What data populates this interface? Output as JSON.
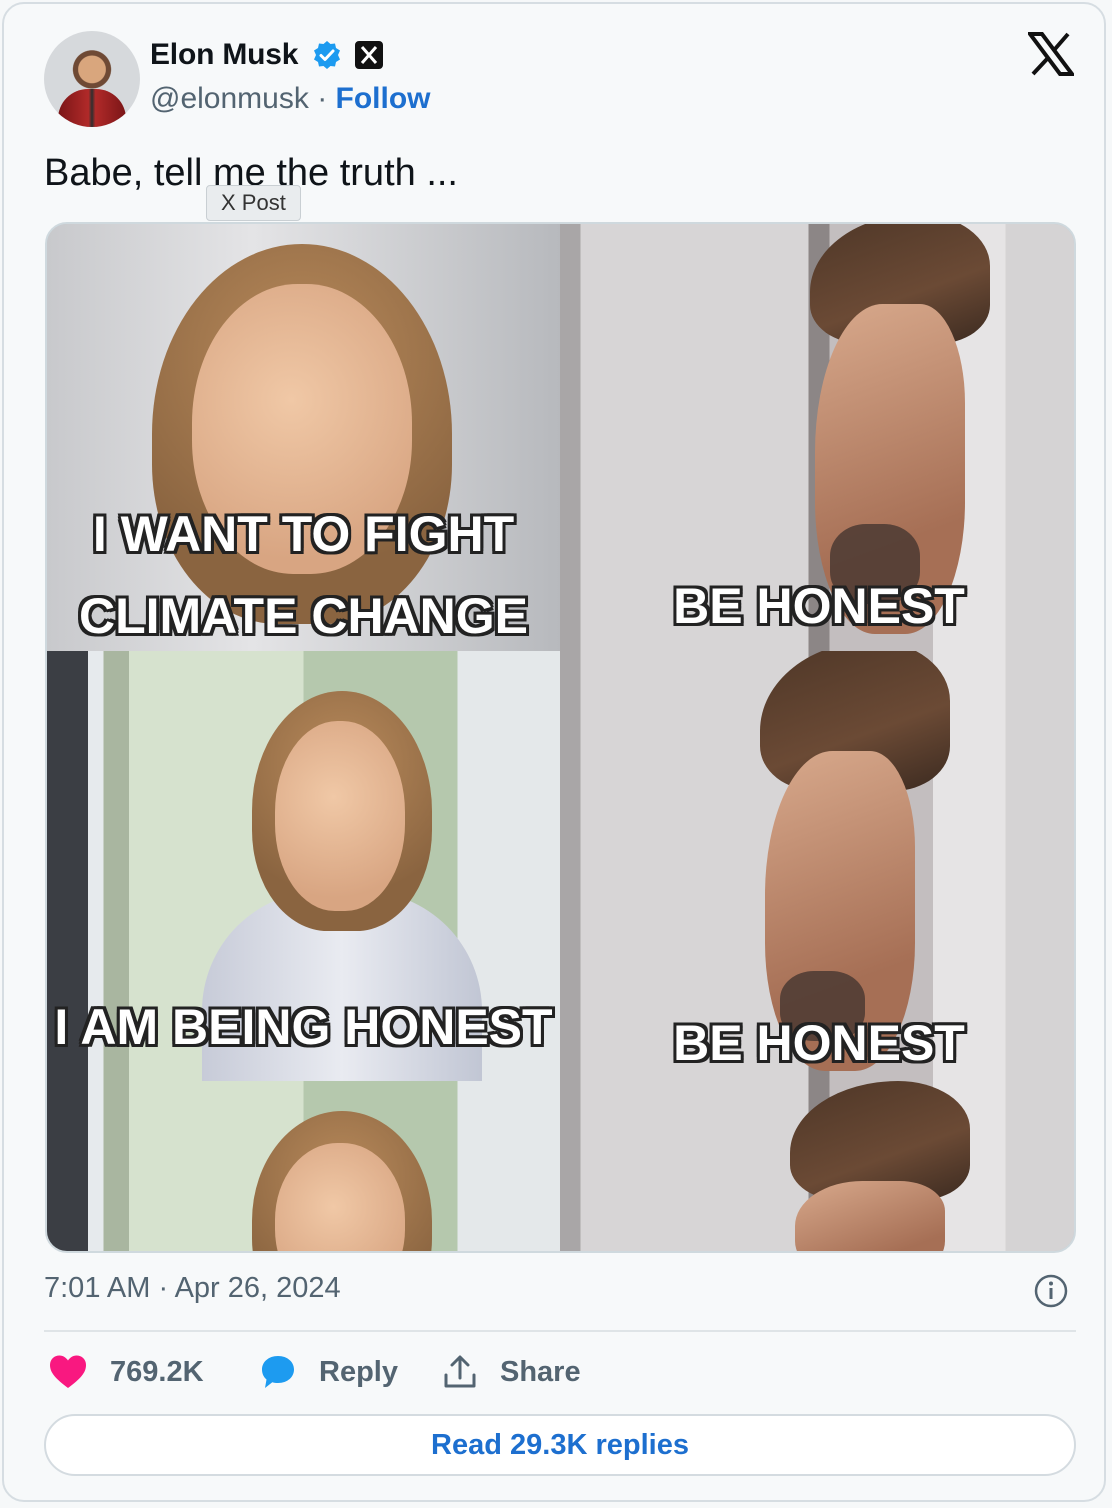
{
  "author": {
    "name": "Elon Musk",
    "handle": "@elonmusk",
    "separator": " · ",
    "follow_label": "Follow"
  },
  "tweet": {
    "text": "Babe, tell me the truth ...",
    "tooltip": "X Post"
  },
  "meme": {
    "captions": [
      "I WANT TO FIGHT",
      "CLIMATE CHANGE",
      "BE HONEST",
      "I AM BEING HONEST",
      "BE HONEST"
    ]
  },
  "meta": {
    "timestamp": "7:01 AM · Apr 26, 2024"
  },
  "actions": {
    "likes": "769.2K",
    "reply_label": "Reply",
    "share_label": "Share"
  },
  "footer": {
    "read_replies": "Read 29.3K replies"
  },
  "colors": {
    "link_blue": "#1d6fcf",
    "like_pink": "#f91880",
    "reply_blue": "#1d9bf0",
    "verified_blue": "#1d9bf0"
  },
  "icons": [
    "verified-badge-icon",
    "x-affiliate-badge-icon",
    "x-logo-icon",
    "info-icon",
    "heart-icon",
    "speech-bubble-icon",
    "share-upload-icon"
  ]
}
